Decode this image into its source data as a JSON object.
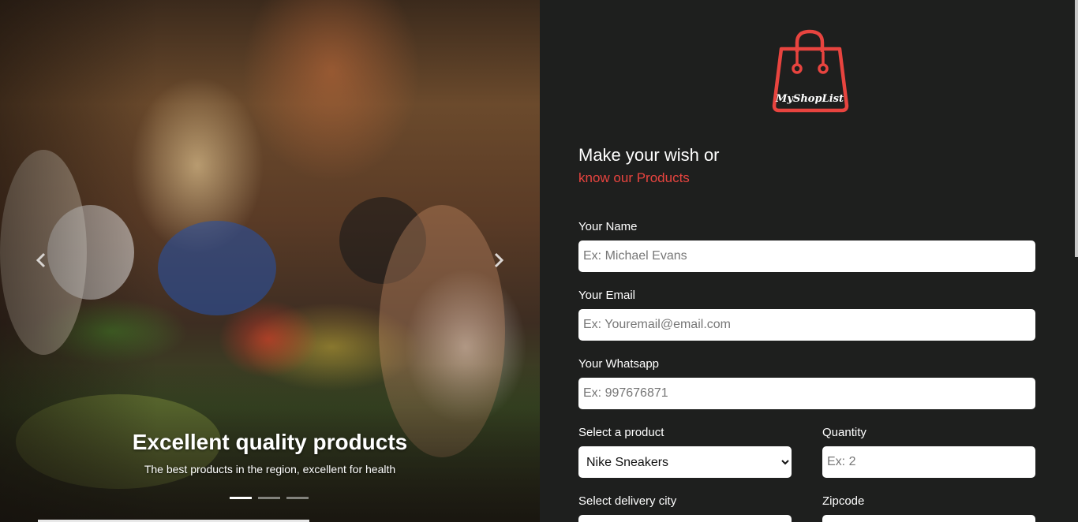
{
  "carousel": {
    "slide_title": "Excellent quality products",
    "slide_subtitle": "The best products in the region, excellent for health",
    "prev_icon": "chevron-left-icon",
    "next_icon": "chevron-right-icon",
    "slides": 3,
    "active_slide": 1
  },
  "brand": {
    "logo_text": "MyShopList",
    "accent_color": "#e8443f"
  },
  "form": {
    "heading": "Make your wish or",
    "subheading": "know our Products",
    "name": {
      "label": "Your Name",
      "placeholder": "Ex: Michael Evans"
    },
    "email": {
      "label": "Your Email",
      "placeholder": "Ex: Youremail@email.com"
    },
    "whatsapp": {
      "label": "Your Whatsapp",
      "placeholder": "Ex: 997676871"
    },
    "product": {
      "label": "Select a product",
      "selected": "Nike Sneakers"
    },
    "quantity": {
      "label": "Quantity",
      "placeholder": "Ex: 2"
    },
    "city": {
      "label": "Select delivery city"
    },
    "zipcode": {
      "label": "Zipcode"
    }
  }
}
